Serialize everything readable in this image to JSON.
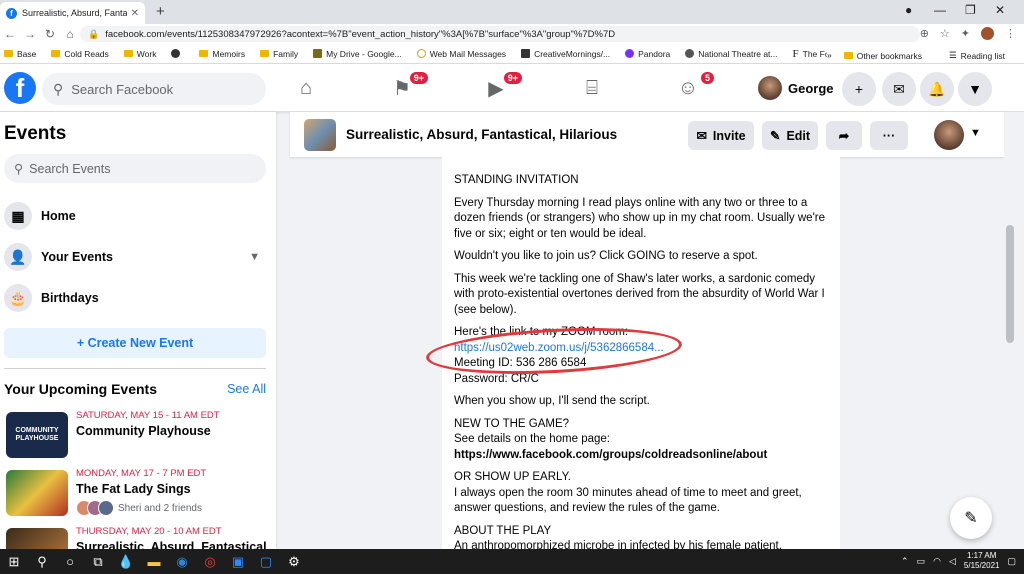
{
  "browser": {
    "tab_title": "Surrealistic, Absurd, Fantastical, H",
    "url": "facebook.com/events/1125308347972926?acontext=%7B\"event_action_history\"%3A[%7B\"surface\"%3A\"group\"%7D%7D",
    "bookmarks": [
      "Base",
      "Cold Reads",
      "Work",
      "Memoirs",
      "Family",
      "My Drive - Google...",
      "Web Mail Messages",
      "CreativeMornings/...",
      "Pandora",
      "National Theatre at...",
      "The Folger SHAKES..."
    ],
    "bookmarks_overflow": "»",
    "other_bookmarks": "Other bookmarks",
    "reading_list": "Reading list"
  },
  "fb": {
    "logo": "f",
    "search_placeholder": "Search Facebook",
    "badges": {
      "pages": "9+",
      "watch": "9+",
      "groups": "5"
    },
    "profile_name": "George"
  },
  "sidebar": {
    "title": "Events",
    "search_placeholder": "Search Events",
    "items": [
      {
        "label": "Home",
        "icon": "calendar-grid-icon"
      },
      {
        "label": "Your Events",
        "icon": "person-icon"
      },
      {
        "label": "Birthdays",
        "icon": "cake-icon"
      }
    ],
    "create_label": "+ Create New Event",
    "upcoming_title": "Your Upcoming Events",
    "see_all": "See All",
    "events": [
      {
        "date": "SATURDAY, MAY 15 - 11 AM EDT",
        "name": "Community Playhouse",
        "thumb_text": "COMMUNITY PLAYHOUSE"
      },
      {
        "date": "MONDAY, MAY 17 - 7 PM EDT",
        "name": "The Fat Lady Sings",
        "friends": "Sheri and 2 friends"
      },
      {
        "date": "THURSDAY, MAY 20 - 10 AM EDT",
        "name": "Surrealistic, Absurd, Fantastical"
      }
    ]
  },
  "event": {
    "title": "Surrealistic, Absurd, Fantastical, Hilarious",
    "invite": "Invite",
    "edit": "Edit",
    "more": "···"
  },
  "content": {
    "p1": "STANDING INVITATION",
    "p2": "Every Thursday morning I read plays online with any two or three to a dozen friends (or strangers) who show up in my chat room. Usually we're five or six; eight or ten would be ideal.",
    "p3": "Wouldn't you like to join us? Click GOING to reserve a spot.",
    "p4": "This week we're tackling one of Shaw's later works, a sardonic comedy with proto-existential overtones derived from the absurdity of World War I (see below).",
    "p5": "Here's the link to my ZOOM room:",
    "zoom_link": "https://us02web.zoom.us/j/5362866584...",
    "meeting_id": "Meeting ID: 536 286 6584",
    "password": "Password: CR/C",
    "p6": "When you show up, I'll send the script.",
    "p7_head": "NEW TO THE GAME?",
    "p7_body": "See details on the home page:",
    "p7_url": "https://www.facebook.com/groups/coldreadsonline/about",
    "p8_head": "OR SHOW UP EARLY.",
    "p8_body": "I always open the room 30 minutes ahead of time to meet and greet, answer questions, and review the rules of the game.",
    "p9_head": "ABOUT THE PLAY",
    "p9_body": "An anthropomorphized microbe in infected by his female patient,"
  },
  "taskbar": {
    "time": "1:17 AM",
    "date": "5/15/2021"
  },
  "colors": {
    "fb_blue": "#1877f2",
    "badge_red": "#e41e3f",
    "annotation_red": "#e0393e"
  }
}
